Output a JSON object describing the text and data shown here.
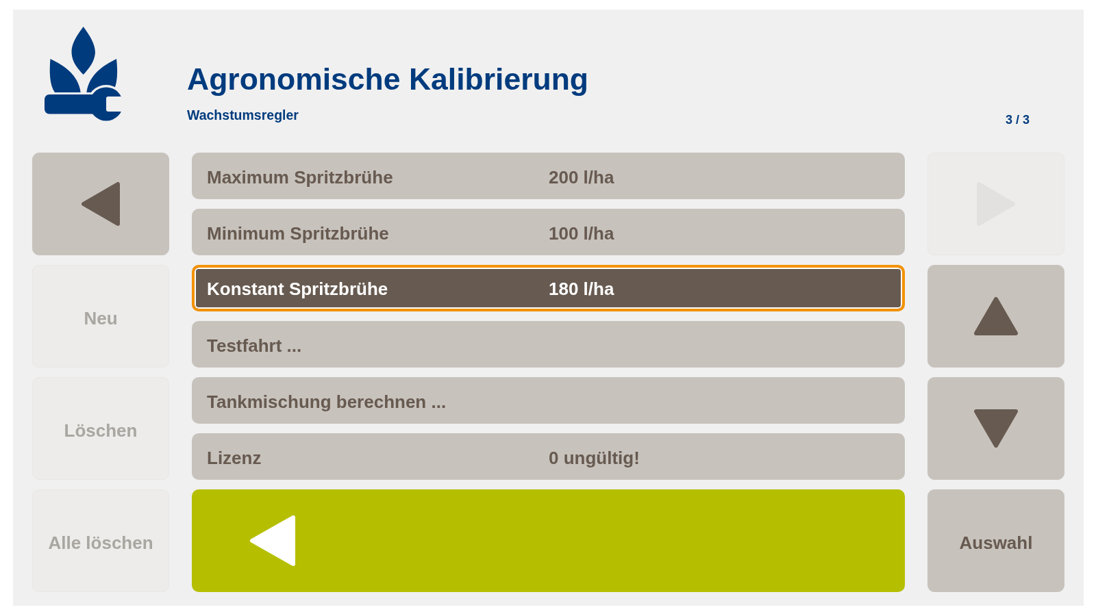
{
  "header": {
    "title": "Agronomische Kalibrierung",
    "subtitle": "Wachstumsregler",
    "page_indicator": "3 / 3"
  },
  "left_buttons": [
    {
      "kind": "back",
      "disabled": false
    },
    {
      "kind": "label",
      "label": "Neu",
      "disabled": true
    },
    {
      "kind": "label",
      "label": "Löschen",
      "disabled": true
    },
    {
      "kind": "label",
      "label": "Alle löschen",
      "disabled": true
    }
  ],
  "list": {
    "items": [
      {
        "label": "Maximum Spritzbrühe",
        "value": "200 l/ha",
        "selected": false
      },
      {
        "label": "Minimum Spritzbrühe",
        "value": "100 l/ha",
        "selected": false
      },
      {
        "label": "Konstant Spritzbrühe",
        "value": "180 l/ha",
        "selected": true
      },
      {
        "label": "Testfahrt ...",
        "selected": false
      },
      {
        "label": "Tankmischung berechnen ...",
        "selected": false
      },
      {
        "label": "Lizenz",
        "value": "0 ungültig!",
        "selected": false
      }
    ]
  },
  "right_buttons": [
    {
      "kind": "forward",
      "disabled": true
    },
    {
      "kind": "up",
      "disabled": false
    },
    {
      "kind": "down",
      "disabled": false
    },
    {
      "kind": "label",
      "label": "Auswahl",
      "disabled": false
    }
  ]
}
